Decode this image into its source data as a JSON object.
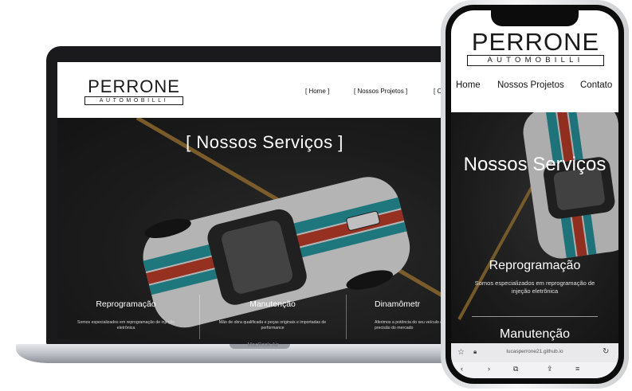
{
  "laptop": {
    "brand": "MacBook Air",
    "logo": {
      "title": "PERRONE",
      "subtitle": "AUTOMOBILLI"
    },
    "nav": [
      "[ Home ]",
      "[ Nossos Projetos ]",
      "[ C"
    ],
    "hero_title": "[ Nossos Serviços ]",
    "services": [
      {
        "title": "Reprogramação",
        "desc": "Somos especializados em reprogramação de injeção eletrônica"
      },
      {
        "title": "Manutenção",
        "desc": "Mão de obra qualificada e peças originais e importadas de performance"
      },
      {
        "title": "Dinamômetr",
        "desc": "Aferimos a potência do seu veículo com a melhor precisão do mercado"
      }
    ]
  },
  "phone": {
    "logo": {
      "title": "PERRONE",
      "subtitle": "AUTOMOBILLI"
    },
    "nav": [
      "Home",
      "Nossos Projetos",
      "Contato"
    ],
    "hero_title": "Nossos Serviços",
    "service_title": "Reprogramação",
    "service_desc": "Somos especializados em reprogramação de injeção eletrônica",
    "next_service_title": "Manutenção",
    "url": "lucasperrone21.github.io"
  },
  "colors": {
    "livery_teal": "#2a9fa8",
    "livery_red": "#c8402c",
    "livery_white": "#f2f2f2",
    "road_line": "#b88a3c"
  },
  "icons": [
    "star-icon",
    "lock-icon",
    "reload-icon",
    "back-icon",
    "forward-icon",
    "tabs-icon",
    "share-icon",
    "menu-icon"
  ]
}
